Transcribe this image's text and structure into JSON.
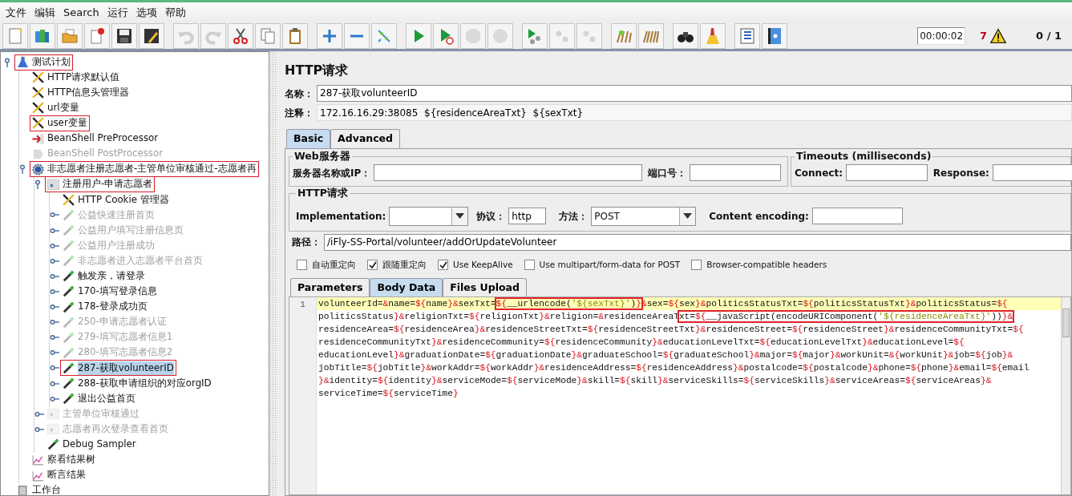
{
  "menu": [
    {
      "label": "文件"
    },
    {
      "label": "编辑"
    },
    {
      "label": "Search"
    },
    {
      "label": "运行"
    },
    {
      "label": "选项"
    },
    {
      "label": "帮助"
    }
  ],
  "toolbar": {
    "groups": [
      [
        {
          "kind": "new",
          "disabled": false
        },
        {
          "kind": "templates",
          "disabled": false
        },
        {
          "kind": "open",
          "disabled": false
        },
        {
          "kind": "close",
          "disabled": false
        },
        {
          "kind": "save",
          "disabled": false
        },
        {
          "kind": "saveas",
          "disabled": false
        }
      ],
      [
        {
          "kind": "undo",
          "disabled": true
        },
        {
          "kind": "redo",
          "disabled": true
        },
        {
          "kind": "cut",
          "disabled": false
        },
        {
          "kind": "copy",
          "disabled": false
        },
        {
          "kind": "paste",
          "disabled": false
        }
      ],
      [
        {
          "kind": "expand",
          "disabled": false
        },
        {
          "kind": "collapse",
          "disabled": false
        },
        {
          "kind": "toggle",
          "disabled": false
        }
      ],
      [
        {
          "kind": "start",
          "disabled": false
        },
        {
          "kind": "start_nopause",
          "disabled": false
        },
        {
          "kind": "stop",
          "disabled": true
        },
        {
          "kind": "shutdown",
          "disabled": true
        }
      ],
      [
        {
          "kind": "remote_start",
          "disabled": false
        },
        {
          "kind": "remote_stop",
          "disabled": true
        },
        {
          "kind": "remote_exit",
          "disabled": true
        }
      ],
      [
        {
          "kind": "clear",
          "disabled": false
        },
        {
          "kind": "clear_all",
          "disabled": false
        }
      ],
      [
        {
          "kind": "search",
          "disabled": false
        },
        {
          "kind": "reset_search",
          "disabled": false
        }
      ],
      [
        {
          "kind": "function",
          "disabled": false
        },
        {
          "kind": "help",
          "disabled": false
        }
      ]
    ]
  },
  "status": {
    "timer": "00:00:02",
    "warnings": "7",
    "threads": "0 / 1"
  },
  "tree": [
    {
      "label": "测试计划",
      "kind": "plan",
      "disabled": false,
      "highlighted": true,
      "selected": false,
      "expanded": true,
      "children": [
        {
          "label": "HTTP请求默认值",
          "kind": "config",
          "disabled": false,
          "highlighted": false,
          "selected": false
        },
        {
          "label": "HTTP信息头管理器",
          "kind": "config",
          "disabled": false,
          "highlighted": false,
          "selected": false
        },
        {
          "label": "url变量",
          "kind": "config",
          "disabled": false,
          "highlighted": false,
          "selected": false
        },
        {
          "label": "user变量",
          "kind": "config",
          "disabled": false,
          "highlighted": true,
          "selected": false
        },
        {
          "label": "BeanShell PreProcessor",
          "kind": "preprocessor",
          "disabled": false,
          "highlighted": false,
          "selected": false
        },
        {
          "label": "BeanShell PostProcessor",
          "kind": "postprocessor",
          "disabled": true,
          "highlighted": false,
          "selected": false
        },
        {
          "label": "非志愿者注册志愿者-主管单位审核通过-志愿者再",
          "kind": "thread",
          "disabled": false,
          "highlighted": true,
          "selected": false,
          "expanded": true,
          "children": [
            {
              "label": "注册用户-申请志愿者",
              "kind": "controller",
              "disabled": false,
              "highlighted": true,
              "selected": false,
              "expanded": true,
              "children": [
                {
                  "label": "HTTP Cookie 管理器",
                  "kind": "config",
                  "disabled": false,
                  "highlighted": false,
                  "selected": false
                },
                {
                  "label": "公益快速注册首页",
                  "kind": "sampler",
                  "disabled": true,
                  "highlighted": false,
                  "selected": false,
                  "expanded": false
                },
                {
                  "label": "公益用户填写注册信息页",
                  "kind": "sampler",
                  "disabled": true,
                  "highlighted": false,
                  "selected": false,
                  "expanded": false
                },
                {
                  "label": "公益用户注册成功",
                  "kind": "sampler",
                  "disabled": true,
                  "highlighted": false,
                  "selected": false,
                  "expanded": false
                },
                {
                  "label": "非志愿者进入志愿者平台首页",
                  "kind": "sampler",
                  "disabled": true,
                  "highlighted": false,
                  "selected": false,
                  "expanded": false
                },
                {
                  "label": "触发亲，请登录",
                  "kind": "sampler",
                  "disabled": false,
                  "highlighted": false,
                  "selected": false,
                  "expanded": false
                },
                {
                  "label": "170-填写登录信息",
                  "kind": "sampler",
                  "disabled": false,
                  "highlighted": false,
                  "selected": false,
                  "expanded": false
                },
                {
                  "label": "178-登录成功页",
                  "kind": "sampler",
                  "disabled": false,
                  "highlighted": false,
                  "selected": false,
                  "expanded": false
                },
                {
                  "label": "250-申请志愿者认证",
                  "kind": "sampler",
                  "disabled": true,
                  "highlighted": false,
                  "selected": false,
                  "expanded": false
                },
                {
                  "label": "279-填写志愿者信息1",
                  "kind": "sampler",
                  "disabled": true,
                  "highlighted": false,
                  "selected": false,
                  "expanded": false
                },
                {
                  "label": "280-填写志愿者信息2",
                  "kind": "sampler",
                  "disabled": true,
                  "highlighted": false,
                  "selected": false,
                  "expanded": false
                },
                {
                  "label": "287-获取volunteerID",
                  "kind": "sampler",
                  "disabled": false,
                  "highlighted": true,
                  "selected": true,
                  "expanded": false
                },
                {
                  "label": "288-获取申请组织的对应orgID",
                  "kind": "sampler",
                  "disabled": false,
                  "highlighted": false,
                  "selected": false,
                  "expanded": false
                },
                {
                  "label": "退出公益首页",
                  "kind": "sampler",
                  "disabled": false,
                  "highlighted": false,
                  "selected": false,
                  "expanded": false
                }
              ]
            },
            {
              "label": "主管单位审核通过",
              "kind": "controller",
              "disabled": true,
              "highlighted": false,
              "selected": false,
              "expanded": false
            },
            {
              "label": "志愿者再次登录查看首页",
              "kind": "controller",
              "disabled": true,
              "highlighted": false,
              "selected": false,
              "expanded": false
            },
            {
              "label": "Debug Sampler",
              "kind": "sampler",
              "disabled": false,
              "highlighted": false,
              "selected": false
            }
          ]
        },
        {
          "label": "察看结果树",
          "kind": "listener",
          "disabled": false,
          "highlighted": false,
          "selected": false
        },
        {
          "label": "断言结果",
          "kind": "listener",
          "disabled": false,
          "highlighted": false,
          "selected": false
        }
      ]
    },
    {
      "label": "工作台",
      "kind": "workbench",
      "disabled": false,
      "highlighted": false,
      "selected": false
    }
  ],
  "editor": {
    "title": "HTTP请求",
    "name_label": "名称：",
    "name": "287-获取volunteerID",
    "comment_label": "注释：",
    "comment": "172.16.16.29:38085  ${residenceAreaTxt}  ${sexTxt}",
    "tabs": [
      {
        "label": "Basic",
        "selected": true
      },
      {
        "label": "Advanced",
        "selected": false
      }
    ],
    "web_server": {
      "legend": "Web服务器",
      "server_label": "服务器名称或IP：",
      "port_label": "端口号："
    },
    "timeouts": {
      "legend": "Timeouts (milliseconds)",
      "connect_label": "Connect:",
      "response_label": "Response:"
    },
    "http_request": {
      "legend": "HTTP请求",
      "implementation_label": "Implementation:",
      "protocol_label": "协议：",
      "protocol": "http",
      "method_label": "方法：",
      "method": "POST",
      "encoding_label": "Content encoding:"
    },
    "path_label": "路径：",
    "path": "/iFly-SS-Portal/volunteer/addOrUpdateVolunteer",
    "options": [
      {
        "label": "自动重定向",
        "checked": false
      },
      {
        "label": "跟随重定向",
        "checked": true
      },
      {
        "label": "Use KeepAlive",
        "checked": true
      },
      {
        "label": "Use multipart/form-data for POST",
        "checked": false
      },
      {
        "label": "Browser-compatible headers",
        "checked": false
      }
    ],
    "subtabs": [
      {
        "label": "Parameters",
        "selected": false
      },
      {
        "label": "Body Data",
        "selected": true
      },
      {
        "label": "Files Upload",
        "selected": false
      }
    ],
    "body": {
      "line_number": "1",
      "lines": [
        {
          "current": true,
          "segments": [
            {
              "text": "volunteerId=&name=${name}&sexTxt=",
              "boxed": false
            },
            {
              "text": "${__urlencode('${sexTxt}')}",
              "boxed": true
            },
            {
              "text": "&sex=${sex}&politicsStatusTxt=${politicsStatusTxt}&politicsStatus=${",
              "boxed": false
            }
          ]
        },
        {
          "current": false,
          "segments": [
            {
              "text": "politicsStatus}&religionTxt=${religionTxt}&religion=&residenceAreaT",
              "boxed": false
            },
            {
              "text": "xt=${__javaScript(encodeURIComponent('${residenceAreaTxt}'))}&",
              "boxed": true
            }
          ]
        },
        {
          "current": false,
          "segments": [
            {
              "text": "residenceArea=${residenceArea}&residenceStreetTxt=${residenceStreetTxt}&residenceStreet=${residenceStreet}&residenceCommunityTxt=${",
              "boxed": false
            }
          ]
        },
        {
          "current": false,
          "segments": [
            {
              "text": "residenceCommunityTxt}&residenceCommunity=${residenceCommunity}&educationLevelTxt=${educationLevelTxt}&educationLevel=${",
              "boxed": false
            }
          ]
        },
        {
          "current": false,
          "segments": [
            {
              "text": "educationLevel}&graduationDate=${graduationDate}&graduateSchool=${graduateSchool}&major=${major}&workUnit=&{workUnit}&job=${job}&",
              "boxed": false
            }
          ]
        },
        {
          "current": false,
          "segments": [
            {
              "text": "jobTitle=${jobTitle}&workAddr=${workAddr}&residenceAddress=${residenceAddress}&postalcode=${postalcode}&phone=${phone}&email=${email",
              "boxed": false
            }
          ]
        },
        {
          "current": false,
          "segments": [
            {
              "text": "}&identity=${identity}&serviceMode=${serviceMode}&skill=${skill}&serviceSkills=${serviceSkills}&serviceAreas=${serviceAreas}&",
              "boxed": false
            }
          ]
        },
        {
          "current": false,
          "segments": [
            {
              "text": "serviceTime=${serviceTime}",
              "boxed": false
            }
          ]
        }
      ]
    }
  }
}
